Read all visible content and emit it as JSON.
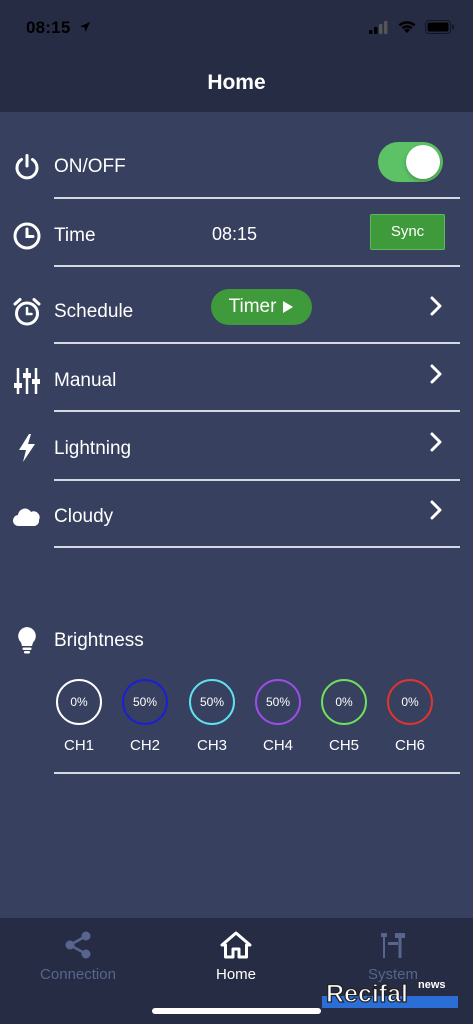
{
  "status_bar": {
    "time": "08:15"
  },
  "nav": {
    "title": "Home"
  },
  "rows": {
    "onoff": {
      "label": "ON/OFF",
      "on": true
    },
    "time": {
      "label": "Time",
      "value": "08:15",
      "sync_label": "Sync"
    },
    "schedule": {
      "label": "Schedule",
      "timer_label": "Timer"
    },
    "manual": {
      "label": "Manual"
    },
    "lightning": {
      "label": "Lightning"
    },
    "cloudy": {
      "label": "Cloudy"
    }
  },
  "brightness": {
    "label": "Brightness",
    "channels": [
      {
        "name": "CH1",
        "value": "0%",
        "color": "#ffffff"
      },
      {
        "name": "CH2",
        "value": "50%",
        "color": "#1a1fd6"
      },
      {
        "name": "CH3",
        "value": "50%",
        "color": "#5ee1ee"
      },
      {
        "name": "CH4",
        "value": "50%",
        "color": "#9b4ee6"
      },
      {
        "name": "CH5",
        "value": "0%",
        "color": "#6fe05c"
      },
      {
        "name": "CH6",
        "value": "0%",
        "color": "#e0342e"
      }
    ]
  },
  "tabs": [
    {
      "label": "Connection",
      "color": "#58658e",
      "active": false
    },
    {
      "label": "Home",
      "color": "#ffffff",
      "active": true
    },
    {
      "label": "System",
      "color": "#58658e",
      "active": false
    }
  ],
  "watermark": {
    "text": "Recifal",
    "superscript": "news"
  },
  "colors": {
    "background": "#37405e",
    "bars": "#252c44",
    "accent_green": "#3f9a3c",
    "toggle_green": "#5dc266"
  }
}
